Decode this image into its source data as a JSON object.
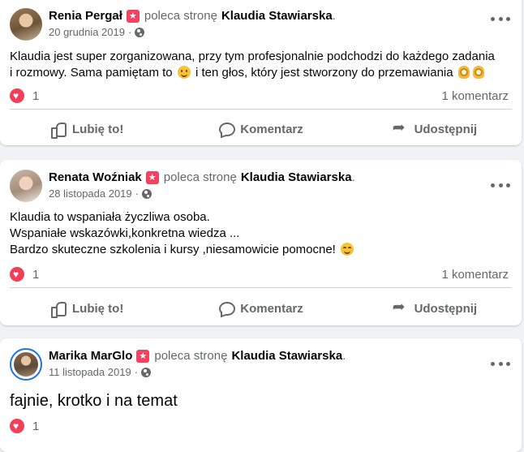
{
  "posts": [
    {
      "author": "Renia Pergał",
      "recommends_text": "poleca stronę",
      "page_name": "Klaudia Stawiarska",
      "date": "20 grudnia 2019",
      "lines": [
        "Klaudia jest super zorganizowana, przy tym profesjonalnie podchodzi do każdego zadania",
        "i rozmowy. Sama pamiętam to",
        "i ten  głos, który jest stworzony do przemawiania"
      ],
      "reaction_count": "1",
      "comment_count": "1 komentarz"
    },
    {
      "author": "Renata Woźniak",
      "recommends_text": "poleca stronę",
      "page_name": "Klaudia Stawiarska",
      "date": "28 listopada 2019",
      "lines": [
        "Klaudia to wspaniała życzliwa osoba.",
        "Wspaniałe wskazówki,konkretna wiedza ...",
        "Bardzo skuteczne szkolenia i kursy ,niesamowicie pomocne!"
      ],
      "reaction_count": "1",
      "comment_count": "1 komentarz"
    },
    {
      "author": "Marika MarGlo",
      "recommends_text": "poleca stronę",
      "page_name": "Klaudia Stawiarska",
      "date": "11 listopada 2019",
      "lines": [
        "fajnie, krotko i na temat"
      ],
      "reaction_count": "1"
    }
  ],
  "actions": {
    "like": "Lubię to!",
    "comment": "Komentarz",
    "share": "Udostępnij"
  },
  "colors": {
    "reaction_heart": "#f33e58",
    "recommend_badge": "#f3425f",
    "muted_text": "#65676b"
  }
}
